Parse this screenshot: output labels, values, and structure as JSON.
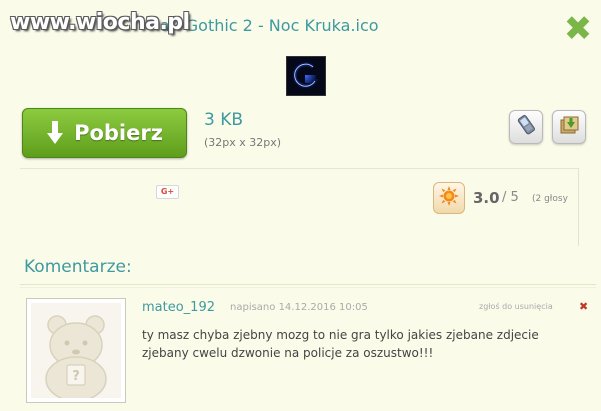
{
  "watermark": "www.wiocha.pl",
  "file": {
    "title": "a - Gothic 2 - Noc Kruka.ico",
    "size": "3 KB",
    "dimensions": "(32px x 32px)"
  },
  "download_label": "Pobierz",
  "close_symbol": "✖",
  "social": {
    "gplus_label": "G+"
  },
  "rating": {
    "score": "3.0",
    "max": "/ 5",
    "votes": "(2 głosy"
  },
  "comments_heading": "Komentarze:",
  "comments": [
    {
      "author": "mateo_192",
      "meta": "napisano 14.12.2016 10:05",
      "report_label": "zgłoś do usunięcia",
      "report_x": "✖",
      "body": "ty masz chyba zjebny mozg to nie gra tylko jakies zjebane zdjecie zjebany cwelu dzwonie na policje za oszustwo!!!"
    }
  ],
  "colors": {
    "accent_teal": "#3e9aa0",
    "button_green": "#6fb02c",
    "page_bg": "#fbfbea"
  },
  "icons": [
    "close-icon",
    "download-arrow-icon",
    "phone-icon",
    "save-icon",
    "sun-rating-icon",
    "hamster-avatar-icon"
  ]
}
